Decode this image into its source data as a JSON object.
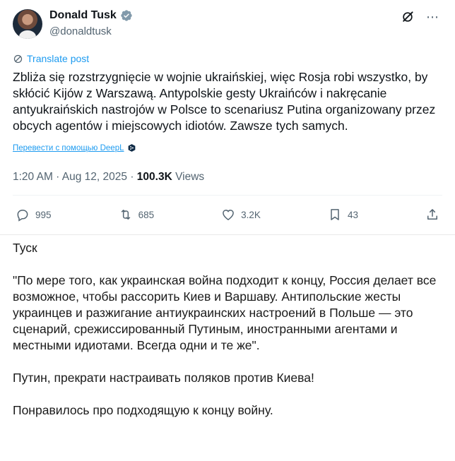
{
  "tweet": {
    "display_name": "Donald Tusk",
    "handle": "@donaldtusk",
    "translate_label": "Translate post",
    "body": "Zbliża się rozstrzygnięcie w wojnie ukraińskiej, więc Rosja robi wszystko, by skłócić Kijów z Warszawą. Antypolskie gesty Ukraińców i nakręcanie antyukraińskich nastrojów w Polsce to scenariusz Putina organizowany przez obcych agentów i miejscowych idiotów. Zawsze tych samych.",
    "deepl_label": "Перевести с помощью DeepL",
    "time": "1:20 AM · Aug 12, 2025 · ",
    "views_count": "100.3K",
    "views_label": " Views",
    "actions": {
      "replies": "995",
      "reposts": "685",
      "likes": "3.2K",
      "bookmarks": "43"
    },
    "colors": {
      "accent": "#1d9bf0",
      "muted": "#536471",
      "text": "#0f1419"
    },
    "icons": [
      "grok-icon",
      "more-icon",
      "verified-icon",
      "translate-icon",
      "deepl-icon",
      "reply-icon",
      "repost-icon",
      "like-icon",
      "bookmark-icon",
      "share-icon"
    ]
  },
  "post": {
    "author": "Туск",
    "quote": "\"По мере того, как украинская война подходит к концу, Россия делает все возможное, чтобы рассорить Киев и Варшаву. Антипольские жесты украинцев и разжигание антиукраинских настроений в Польше — это сценарий, срежиссированный Путиным, иностранными агентами и местными идиотами. Всегда одни и те же\".",
    "appeal": "Путин, прекрати настраивать поляков против Киева!",
    "comment": "Понравилось про подходящую к концу войну."
  }
}
